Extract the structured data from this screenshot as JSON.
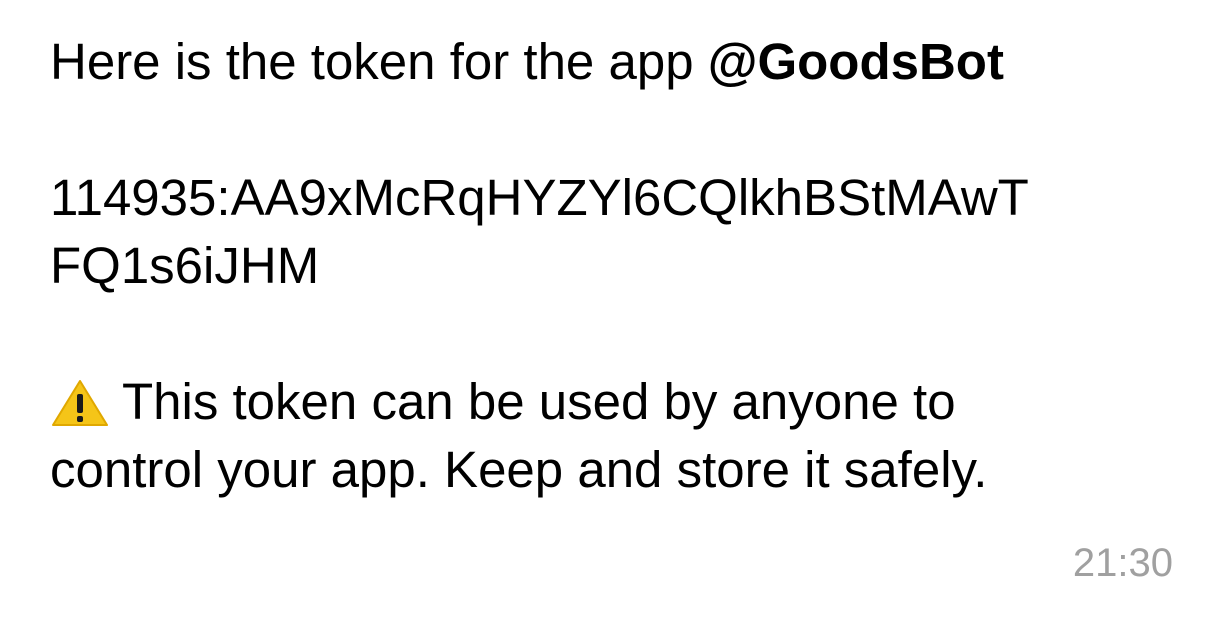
{
  "message": {
    "intro_text": "Here is the token for the app ",
    "app_handle": "@GoodsBot",
    "token_line1": "114935:AA9xMcRqHYZYl6CQlkhBStMAwT",
    "token_line2": "FQ1s6iJHM",
    "warning_icon": "warning-icon",
    "warning_line1": "This token can be used by anyone to",
    "warning_line2": "control your app. Keep and store it safely.",
    "timestamp": "21:30"
  },
  "colors": {
    "text": "#000000",
    "timestamp": "#a0a0a0",
    "warning_fill": "#f5c518"
  }
}
